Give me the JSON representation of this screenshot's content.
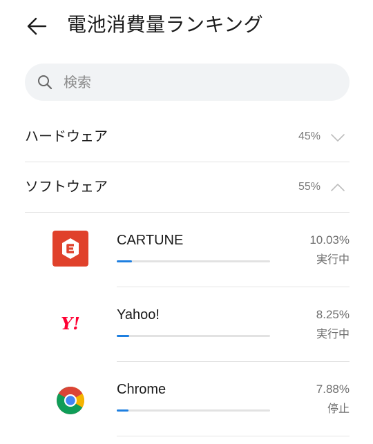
{
  "header": {
    "title": "電池消費量ランキング",
    "back_icon": "arrow-left-icon"
  },
  "search": {
    "placeholder": "検索",
    "icon": "search-icon"
  },
  "categories": [
    {
      "label": "ハードウェア",
      "percent": "45%",
      "expanded": false
    },
    {
      "label": "ソフトウェア",
      "percent": "55%",
      "expanded": true
    }
  ],
  "apps": [
    {
      "name": "CARTUNE",
      "percent": "10.03%",
      "status": "実行中",
      "usage": 0.1003,
      "icon": "cartune-logo"
    },
    {
      "name": "Yahoo!",
      "percent": "8.25%",
      "status": "実行中",
      "usage": 0.0825,
      "icon": "yahoo-logo"
    },
    {
      "name": "Chrome",
      "percent": "7.88%",
      "status": "停止",
      "usage": 0.0788,
      "icon": "chrome-logo"
    }
  ],
  "colors": {
    "accent": "#1e7fe0",
    "cartune": "#e0412b",
    "yahoo": "#ff0033"
  }
}
